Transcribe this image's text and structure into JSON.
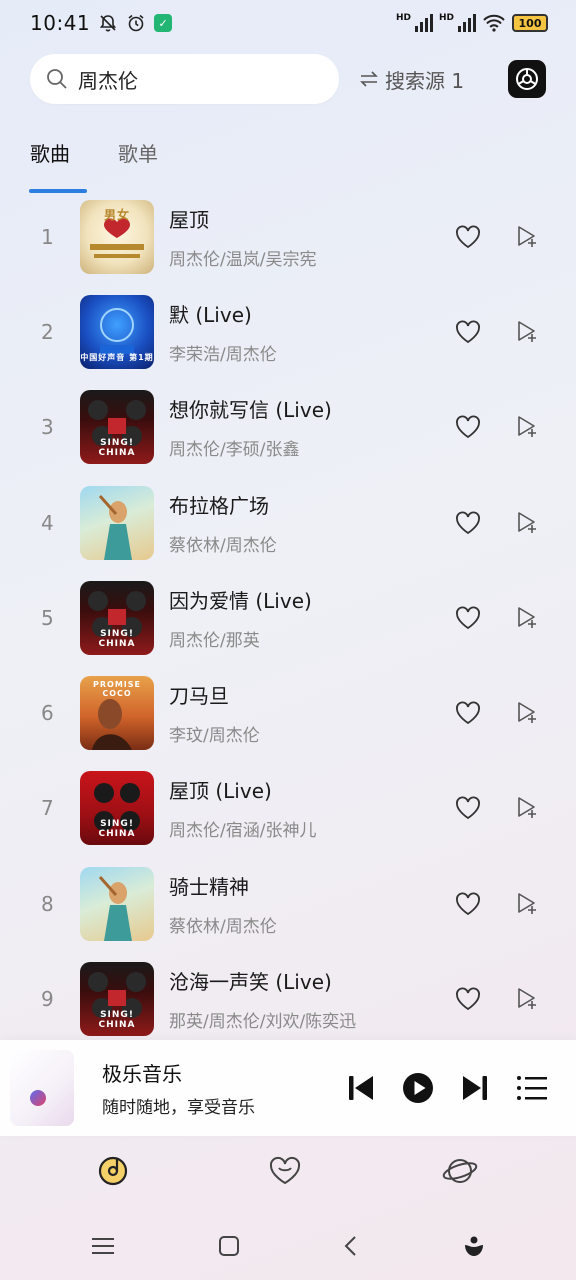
{
  "status_bar": {
    "time": "10:41",
    "battery": "100"
  },
  "search": {
    "value": "周杰伦",
    "source_label": "搜索源 1"
  },
  "tabs": [
    {
      "label": "歌曲",
      "active": true
    },
    {
      "label": "歌单",
      "active": false
    }
  ],
  "songs": [
    {
      "index": "1",
      "title": "屋顶",
      "artist": "周杰伦/温岚/吴宗宪"
    },
    {
      "index": "2",
      "title": "默 (Live)",
      "artist": "李荣浩/周杰伦"
    },
    {
      "index": "3",
      "title": "想你就写信 (Live)",
      "artist": "周杰伦/李硕/张鑫"
    },
    {
      "index": "4",
      "title": "布拉格广场",
      "artist": "蔡依林/周杰伦"
    },
    {
      "index": "5",
      "title": "因为爱情 (Live)",
      "artist": "周杰伦/那英"
    },
    {
      "index": "6",
      "title": "刀马旦",
      "artist": "李玟/周杰伦"
    },
    {
      "index": "7",
      "title": "屋顶 (Live)",
      "artist": "周杰伦/宿涵/张神儿"
    },
    {
      "index": "8",
      "title": "骑士精神",
      "artist": "蔡依林/周杰伦"
    },
    {
      "index": "9",
      "title": "沧海一声笑 (Live)",
      "artist": "那英/周杰伦/刘欢/陈奕迅"
    }
  ],
  "covers": {
    "cover1": "男女",
    "cover2": "中国好声音 第1期",
    "cover3": "SING! CHINA",
    "cover6": "PROMISE COCO",
    "cover7": "SING! CHINA"
  },
  "player": {
    "title": "极乐音乐",
    "subtitle": "随时随地，享受音乐"
  },
  "colors": {
    "accent": "#2c7fe0",
    "heart_icon": "#333333",
    "text_secondary": "#8a8a8a"
  },
  "icons": {
    "bottom_nav": [
      "music-disc-icon",
      "heart-icon",
      "planet-icon"
    ],
    "system_nav": [
      "menu-icon",
      "home-icon",
      "back-icon",
      "assistant-icon"
    ]
  }
}
